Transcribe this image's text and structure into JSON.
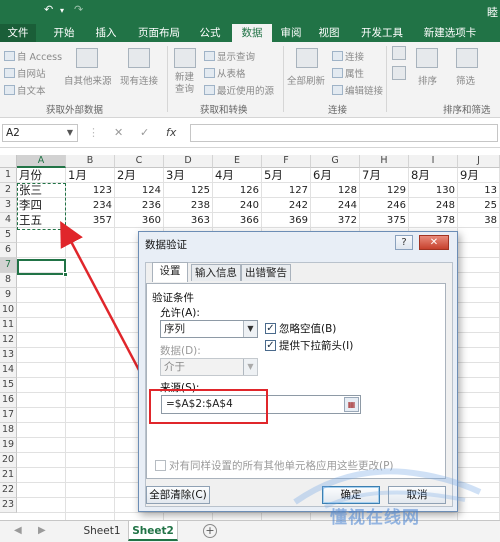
{
  "titlebar": {
    "undo": "↶",
    "redo": "↷",
    "truncated": "睦"
  },
  "tabs": [
    "文件",
    "开始",
    "插入",
    "页面布局",
    "公式",
    "数据",
    "审阅",
    "视图",
    "开发工具",
    "新建选项卡"
  ],
  "ribbon": {
    "external": {
      "access": "自 Access",
      "web": "自网站",
      "text": "自文本",
      "other": "自其他来源",
      "existing": "现有连接",
      "label": "获取外部数据"
    },
    "transform": {
      "new_query": "新建\n查询",
      "show_queries": "显示查询",
      "from_table": "从表格",
      "recent": "最近使用的源",
      "label": "获取和转换"
    },
    "connections": {
      "refresh_all": "全部刷新",
      "connections": "连接",
      "properties": "属性",
      "edit_links": "编辑链接",
      "label": "连接"
    },
    "sort_filter": {
      "sort": "排序",
      "filter": "筛选",
      "label": "排序和筛选"
    }
  },
  "formula_bar": {
    "name_box": "A2",
    "cancel": "✕",
    "enter": "✓",
    "fx": "fx",
    "formula": ""
  },
  "columns": [
    "A",
    "B",
    "C",
    "D",
    "E",
    "F",
    "G",
    "H",
    "I",
    "J"
  ],
  "rows": [
    "1",
    "2",
    "3",
    "4",
    "5",
    "6",
    "7",
    "8",
    "9",
    "10",
    "11",
    "12",
    "13",
    "14",
    "15",
    "16",
    "17",
    "18",
    "19",
    "20",
    "21",
    "22",
    "23"
  ],
  "sheet": {
    "header": [
      "月份",
      "1月",
      "2月",
      "3月",
      "4月",
      "5月",
      "6月",
      "7月",
      "8月",
      "9月"
    ],
    "data": [
      [
        "张三",
        "123",
        "124",
        "125",
        "126",
        "127",
        "128",
        "129",
        "130",
        "13"
      ],
      [
        "李四",
        "234",
        "236",
        "238",
        "240",
        "242",
        "244",
        "246",
        "248",
        "25"
      ],
      [
        "王五",
        "357",
        "360",
        "363",
        "366",
        "369",
        "372",
        "375",
        "378",
        "38"
      ]
    ]
  },
  "sheet_tabs": [
    "Sheet1",
    "Sheet2"
  ],
  "add_sheet": "+",
  "dialog": {
    "title": "数据验证",
    "help": "?",
    "close": "✕",
    "tabs": [
      "设置",
      "输入信息",
      "出错警告"
    ],
    "criteria_label": "验证条件",
    "allow_label": "允许(A):",
    "allow_value": "序列",
    "data_label": "数据(D):",
    "data_value": "介于",
    "ignore_blank": "忽略空值(B)",
    "dropdown": "提供下拉箭头(I)",
    "source_label": "来源(S):",
    "source_value": "=$A$2:$A$4",
    "apply_all": "对有同样设置的所有其他单元格应用这些更改(P)",
    "clear_all": "全部清除(C)",
    "ok": "确定",
    "cancel": "取消",
    "check_mark": "✓"
  },
  "watermark": "懂视在线网",
  "colors": {
    "excel_green": "#217346",
    "annotation_red": "#e0262b"
  }
}
